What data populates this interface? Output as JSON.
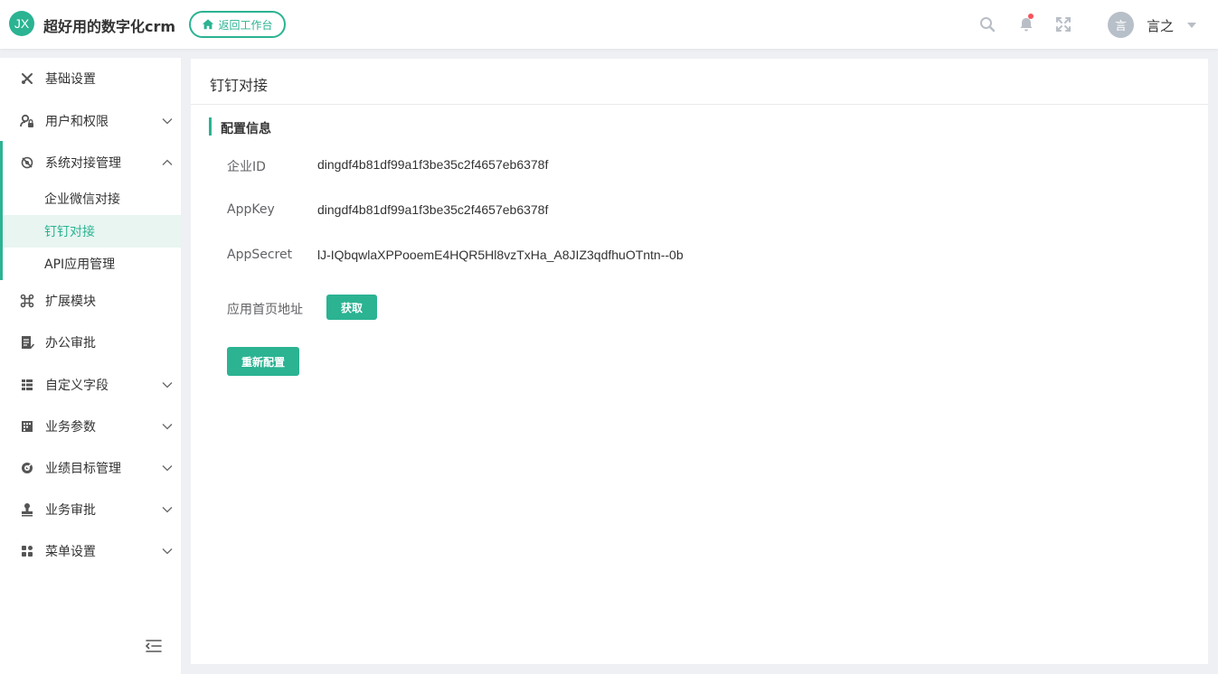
{
  "header": {
    "logo_text": "JX",
    "app_title": "超好用的数字化crm",
    "back_button_label": "返回工作台",
    "user": {
      "avatar_text": "言",
      "name": "言之"
    },
    "colors": {
      "accent": "#2bb392",
      "notification_dot": "#f5535a"
    },
    "icons": [
      "search-icon",
      "bell-icon",
      "fullscreen-icon",
      "chevron-down-icon"
    ]
  },
  "sidebar": {
    "items": [
      {
        "label": "基础设置",
        "icon": "tools-icon",
        "expandable": false
      },
      {
        "label": "用户和权限",
        "icon": "user-lock-icon",
        "expandable": true,
        "expanded": false
      },
      {
        "label": "系统对接管理",
        "icon": "connect-icon",
        "expandable": true,
        "expanded": true
      },
      {
        "label": "扩展模块",
        "icon": "command-icon",
        "expandable": false
      },
      {
        "label": "办公审批",
        "icon": "document-icon",
        "expandable": false
      },
      {
        "label": "自定义字段",
        "icon": "list-icon",
        "expandable": true,
        "expanded": false
      },
      {
        "label": "业务参数",
        "icon": "grid-icon",
        "expandable": true,
        "expanded": false
      },
      {
        "label": "业绩目标管理",
        "icon": "target-icon",
        "expandable": true,
        "expanded": false
      },
      {
        "label": "业务审批",
        "icon": "stamp-icon",
        "expandable": true,
        "expanded": false
      },
      {
        "label": "菜单设置",
        "icon": "apps-icon",
        "expandable": true,
        "expanded": false
      }
    ],
    "sub_items": [
      {
        "label": "企业微信对接",
        "active": false
      },
      {
        "label": "钉钉对接",
        "active": true
      },
      {
        "label": "API应用管理",
        "active": false
      }
    ]
  },
  "main": {
    "page_title": "钉钉对接",
    "section_title": "配置信息",
    "fields": [
      {
        "label": "企业ID",
        "value": "dingdf4b81df99a1f3be35c2f4657eb6378f"
      },
      {
        "label": "AppKey",
        "value": "dingdf4b81df99a1f3be35c2f4657eb6378f"
      },
      {
        "label": "AppSecret",
        "value": "lJ-IQbqwlaXPPooemE4HQR5Hl8vzTxHa_A8JIZ3qdfhuOTntn--0b"
      }
    ],
    "homepage_label": "应用首页地址",
    "fetch_button_label": "获取",
    "reconfigure_button_label": "重新配置"
  }
}
